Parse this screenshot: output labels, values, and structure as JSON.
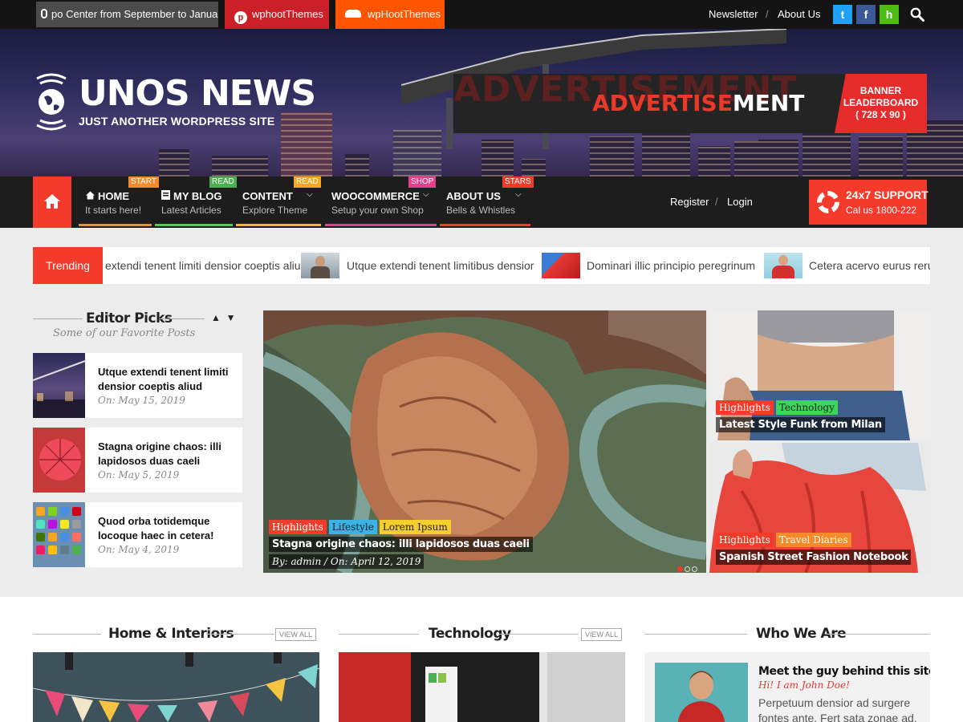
{
  "topbar": {
    "announcement": "po Center from September to January.",
    "pinterest_label": "wphootThemes",
    "soundcloud_label": "wpHootThemes",
    "links": [
      "Newsletter",
      "About Us"
    ],
    "separator": "/",
    "social": [
      {
        "icon": "twitter-icon",
        "glyph": "t",
        "color": "#1da1f2"
      },
      {
        "icon": "facebook-icon",
        "glyph": "f",
        "color": "#3b5998"
      },
      {
        "icon": "houzz-icon",
        "glyph": "h",
        "color": "#4dbc15"
      }
    ],
    "pinterest_glyph": "p"
  },
  "header": {
    "site_title": "UNOS NEWS",
    "tagline": "JUST ANOTHER WORDPRESS SITE",
    "ad": {
      "ghost_text": "ADVERTISEMENT",
      "main_red": "ADVERTISE",
      "main_white": "MENT",
      "side_lines": [
        "BANNER",
        "LEADERBOARD",
        "( 728 X 90 )"
      ]
    }
  },
  "nav": {
    "items": [
      {
        "label": "HOME",
        "sub": "It starts here!",
        "badge": "START",
        "bar": "#f58a2b",
        "badge_color": "#f58a2b"
      },
      {
        "label": "MY BLOG",
        "sub": "Latest Articles",
        "badge": "READ",
        "bar": "#3ed65a",
        "badge_color": "#4caf50"
      },
      {
        "label": "CONTENT",
        "sub": "Explore Theme",
        "badge": "READ",
        "bar": "#f5b72b",
        "badge_color": "#f5a623"
      },
      {
        "label": "WOOCOMMERCE",
        "sub": "Setup your own Shop",
        "badge": "SHOP",
        "bar": "#e83e8c",
        "badge_color": "#e83e8c"
      },
      {
        "label": "ABOUT US",
        "sub": "Bells & Whistles",
        "badge": "STARS",
        "bar": "#f43b2b",
        "badge_color": "#f43b2b"
      }
    ],
    "right_links": [
      "Register",
      "Login"
    ],
    "separator": "/",
    "support_title": "24x7 SUPPORT",
    "support_sub": "Cal us 1800-222"
  },
  "trending": {
    "label": "Trending",
    "items": [
      "extendi tenent limiti densior coeptis aliud",
      "Utque extendi tenent limitibus densior",
      "Dominari illic principio peregrinum",
      "Cetera acervo eurus rerum"
    ]
  },
  "editor_picks": {
    "title": "Editor Picks",
    "subtitle": "Some of our Favorite Posts",
    "posts": [
      {
        "title": "Utque extendi tenent limiti densior coeptis aliud",
        "date": "On:  May 15, 2019"
      },
      {
        "title": "Stagna origine chaos: illi lapidosos duas caeli",
        "date": "On:  May 5, 2019"
      },
      {
        "title": "Quod orba totidemque locoque haec in cetera!",
        "date": "On:  May 4, 2019"
      }
    ]
  },
  "featured": {
    "main": {
      "tags": [
        "Highlights",
        "Lifestyle",
        "Lorem Ipsum"
      ],
      "title": "Stagna origine chaos: illi lapidosos duas caeli",
      "meta": "By:  admin  /  On:  April 12, 2019"
    },
    "side": [
      {
        "tags": [
          "Highlights",
          "Technology"
        ],
        "title": "Latest Style Funk from Milan"
      },
      {
        "tags": [
          "Highlights",
          "Travel Diaries"
        ],
        "title": "Spanish Street Fashion Notebook"
      }
    ],
    "slider": {
      "current": 1,
      "total": 3
    }
  },
  "sections": [
    {
      "title": "Home & Interiors",
      "view_all": "VIEW ALL"
    },
    {
      "title": "Technology",
      "view_all": "VIEW ALL"
    },
    {
      "title": "Who We Are"
    }
  ],
  "who": {
    "title": "Meet the guy behind this site",
    "subtitle": "Hi! I am John Doe!",
    "desc": "Perpetuum densior ad surgere fontes ante. Fert sata zonae ad."
  }
}
